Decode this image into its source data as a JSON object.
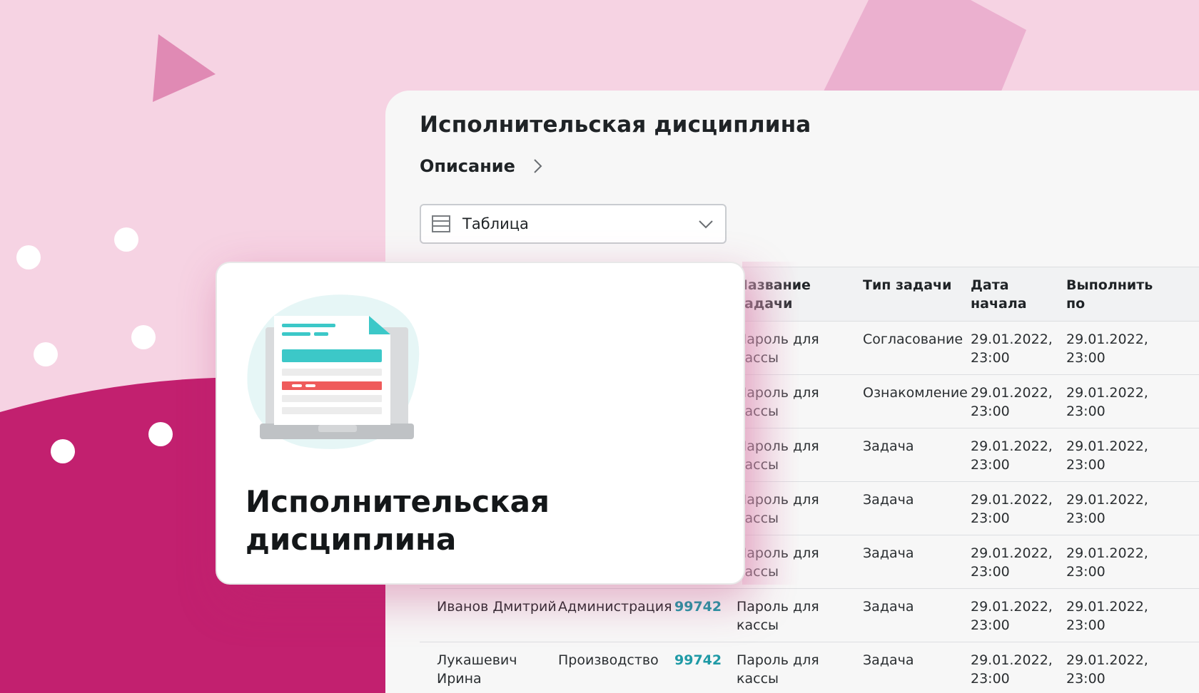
{
  "panel": {
    "title": "Исполнительская дисциплина",
    "breadcrumb": {
      "label": "Описание",
      "icon": "chevron-right-icon"
    },
    "view_select": {
      "value": "Таблица",
      "icon": "table-icon",
      "dropdown_icon": "chevron-down-icon"
    }
  },
  "table": {
    "headers": {
      "task_name": "Название задачи",
      "task_type": "Тип задачи",
      "start_date": "Дата начала",
      "due_date": "Выполнить по"
    },
    "rows": [
      {
        "name": "",
        "dept": "",
        "id": "",
        "task": "Пароль для кассы",
        "type": "Согласование",
        "start": "29.01.2022, 23:00",
        "due": "29.01.2022, 23:00"
      },
      {
        "name": "",
        "dept": "",
        "id": "",
        "task": "Пароль для кассы",
        "type": "Ознакомление",
        "start": "29.01.2022, 23:00",
        "due": "29.01.2022, 23:00"
      },
      {
        "name": "",
        "dept": "",
        "id": "",
        "task": "Пароль для кассы",
        "type": "Задача",
        "start": "29.01.2022, 23:00",
        "due": "29.01.2022, 23:00"
      },
      {
        "name": "",
        "dept": "",
        "id": "",
        "task": "Пароль для кассы",
        "type": "Задача",
        "start": "29.01.2022, 23:00",
        "due": "29.01.2022, 23:00"
      },
      {
        "name": "",
        "dept": "",
        "id": "",
        "task": "Пароль для кассы",
        "type": "Задача",
        "start": "29.01.2022, 23:00",
        "due": "29.01.2022, 23:00"
      },
      {
        "name": "Иванов Дмитрий",
        "dept": "Администрация",
        "id": "99742",
        "task": "Пароль для кассы",
        "type": "Задача",
        "start": "29.01.2022, 23:00",
        "due": "29.01.2022, 23:00"
      },
      {
        "name": "Лукашевич Ирина",
        "dept": "Производство",
        "id": "99742",
        "task": "Пароль для кассы",
        "type": "Задача",
        "start": "29.01.2022, 23:00",
        "due": "29.01.2022, 23:00"
      }
    ]
  },
  "card": {
    "title": "Исполнительская дисциплина",
    "illustration": "laptop-document-icon"
  },
  "colors": {
    "bg_light_pink": "#f6d3e3",
    "bg_magenta": "#c2206f",
    "accent_teal": "#3cc8c8",
    "accent_red": "#ef5b5b",
    "link": "#1f9aa6"
  }
}
